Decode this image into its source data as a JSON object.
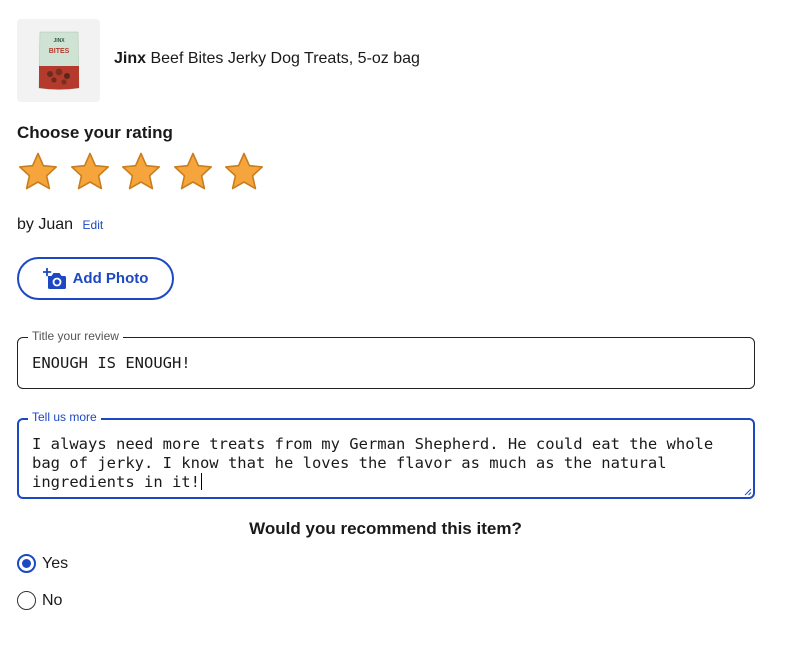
{
  "product": {
    "brand": "Jinx",
    "name": "Beef Bites Jerky Dog Treats, 5-oz bag",
    "thumbnail_text": {
      "brand": "JINX",
      "label": "BITES"
    }
  },
  "rating": {
    "heading": "Choose your rating",
    "value": 5,
    "max": 5,
    "star_color": "#f5a53b",
    "star_outline": "#c97d1c"
  },
  "author": {
    "prefix": "by",
    "name": "Juan",
    "edit_label": "Edit"
  },
  "add_photo": {
    "label": "Add Photo",
    "icon": "camera-plus-icon"
  },
  "title_field": {
    "label": "Title your review",
    "value": "ENOUGH IS ENOUGH!"
  },
  "details_field": {
    "label": "Tell us more",
    "value": "I always need more treats from my German Shepherd. He could eat the whole bag of jerky. I know that he loves the flavor as much as the natural ingredients in it!"
  },
  "recommend": {
    "question": "Would you recommend this item?",
    "options": [
      {
        "label": "Yes",
        "selected": true
      },
      {
        "label": "No",
        "selected": false
      }
    ]
  },
  "colors": {
    "accent": "#1c49c2",
    "text": "#1a1a1a"
  }
}
